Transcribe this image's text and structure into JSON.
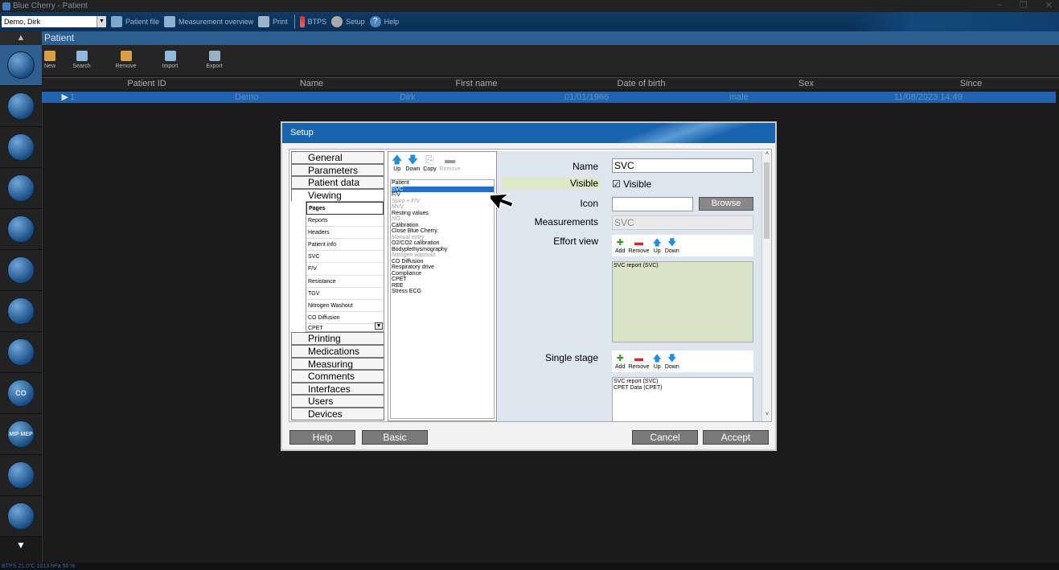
{
  "window": {
    "title": "Blue Cherry - Patient",
    "controls": [
      "–",
      "❐",
      "✕"
    ]
  },
  "toolbar": {
    "patient_select": "Demo, Dirk",
    "patient_file": "Patient file",
    "measurement_overview": "Measurement overview",
    "print": "Print",
    "btps": "BTPS",
    "setup": "Setup",
    "help": "Help"
  },
  "sidebar": {
    "items": [
      "patient",
      "spirometry",
      "flow-volume",
      "body-box",
      "diffusion",
      "resistance",
      "nitrogen",
      "compliance",
      "co",
      "mip-mep",
      "cpet",
      "ree"
    ],
    "co_label": "CO",
    "mipmep_label": "MIP MEP"
  },
  "module": {
    "title": "Patient",
    "buttons": {
      "new": "New",
      "search": "Search",
      "remove": "Remove",
      "import": "Import",
      "export": "Export"
    }
  },
  "grid": {
    "columns": [
      "Patient ID",
      "Name",
      "First name",
      "Date of birth",
      "Sex",
      "Since"
    ],
    "row": {
      "indicator": "▶",
      "patient_id": "1",
      "name": "Demo",
      "first_name": "Dirk",
      "date_of_birth": "01/01/1966",
      "sex": "male",
      "since": "11/08/2023 14:49"
    }
  },
  "status": {
    "text": "BTPS   21.0°C  1013 hPa   50 %"
  },
  "dialog": {
    "title": "Setup",
    "categories_top": [
      "General",
      "Parameters",
      "Patient data",
      "Viewing"
    ],
    "viewing_items": [
      "Pages",
      "Reports",
      "Headers",
      "Patient info",
      "SVC",
      "F/V",
      "Resistance",
      "TGV",
      "Nitrogen Washout",
      "CO Diffusion",
      "CPET"
    ],
    "categories_bottom": [
      "Printing",
      "Medications",
      "Measuring",
      "Comments",
      "Interfaces",
      "Users",
      "Devices"
    ],
    "page_tools": {
      "up": "Up",
      "down": "Down",
      "copy": "Copy",
      "remove": "Remove"
    },
    "pages": [
      {
        "label": "Patient",
        "state": "normal"
      },
      {
        "label": "SVC",
        "state": "selected"
      },
      {
        "label": "F/V",
        "state": "normal"
      },
      {
        "label": "Spiro + F/V",
        "state": "disabled"
      },
      {
        "label": "MVV",
        "state": "disabled"
      },
      {
        "label": "Resting values",
        "state": "normal"
      },
      {
        "label": "NO",
        "state": "disabled"
      },
      {
        "label": "Calibration",
        "state": "normal"
      },
      {
        "label": "Close Blue Cherry.",
        "state": "normal"
      },
      {
        "label": "Manual entry",
        "state": "disabled"
      },
      {
        "label": "O2/CO2 calibration",
        "state": "normal"
      },
      {
        "label": "Bodyplethysmography",
        "state": "normal"
      },
      {
        "label": "Nitrogen washout",
        "state": "disabled"
      },
      {
        "label": "CO Diffusion",
        "state": "normal"
      },
      {
        "label": "Respiratory drive",
        "state": "normal"
      },
      {
        "label": "Compliance",
        "state": "normal"
      },
      {
        "label": "CPET",
        "state": "normal"
      },
      {
        "label": "REE",
        "state": "normal"
      },
      {
        "label": "Stress ECG",
        "state": "normal"
      }
    ],
    "props": {
      "name_label": "Name",
      "name_value": "SVC",
      "visible_label": "Visible",
      "visible_check": "☑ Visible",
      "icon_label": "Icon",
      "icon_value": "",
      "browse": "Browse",
      "measurements_label": "Measurements",
      "measurements_value": "SVC",
      "effort_label": "Effort view",
      "single_label": "Single stage",
      "list_tools": {
        "add": "Add",
        "remove": "Remove",
        "up": "Up",
        "down": "Down"
      },
      "effort_items": [
        "SVC report (SVC)"
      ],
      "single_items": [
        "SVC report (SVC)",
        "CPET Data (CPET)"
      ]
    },
    "buttons": {
      "help": "Help",
      "basic": "Basic",
      "cancel": "Cancel",
      "accept": "Accept"
    }
  },
  "colors": {
    "accent": "#1e6fd0",
    "toolbar": "#0e3a64",
    "visible_highlight": "#dde8c6",
    "effort_list_bg": "#d8e4c5"
  }
}
